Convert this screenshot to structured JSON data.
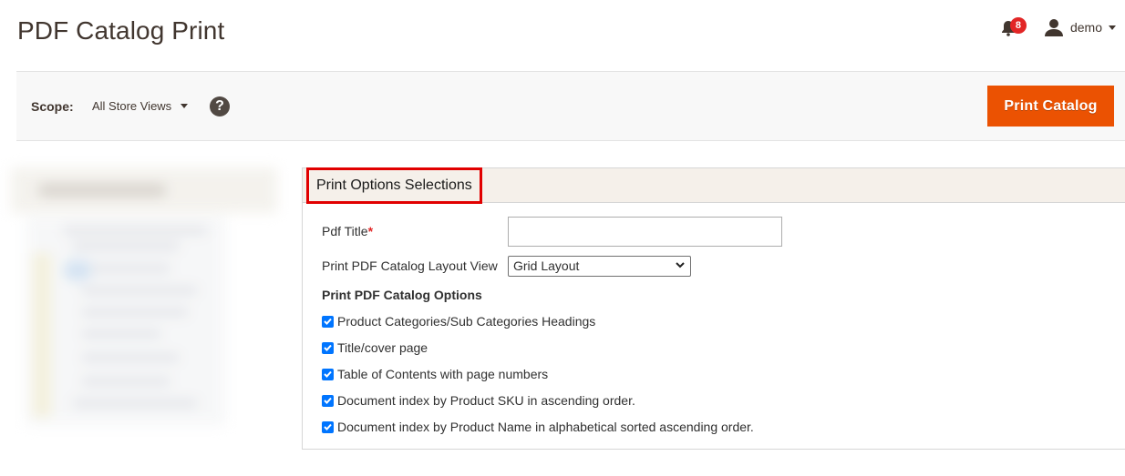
{
  "header": {
    "page_title": "PDF Catalog Print",
    "notifications_count": "8",
    "user_name": "demo"
  },
  "toolbar": {
    "scope_label": "Scope:",
    "scope_value": "All Store Views",
    "help_glyph": "?",
    "print_button_label": "Print Catalog"
  },
  "colors": {
    "accent": "#eb5202",
    "badge": "#e22626",
    "highlight_box": "#e10000",
    "checkbox": "#0075ff"
  },
  "panel": {
    "title": "Print Options Selections",
    "pdf_title_label": "Pdf Title",
    "pdf_title_required_mark": "*",
    "pdf_title_value": "",
    "layout_view_label": "Print PDF Catalog Layout View",
    "layout_view_selected": "Grid Layout",
    "options_heading": "Print PDF Catalog Options",
    "options": [
      {
        "label": "Product Categories/Sub Categories Headings",
        "checked": true
      },
      {
        "label": "Title/cover page",
        "checked": true
      },
      {
        "label": "Table of Contents with page numbers",
        "checked": true
      },
      {
        "label": "Document index by Product SKU in ascending order.",
        "checked": true
      },
      {
        "label": "Document index by Product Name in alphabetical sorted ascending order.",
        "checked": true
      }
    ]
  }
}
